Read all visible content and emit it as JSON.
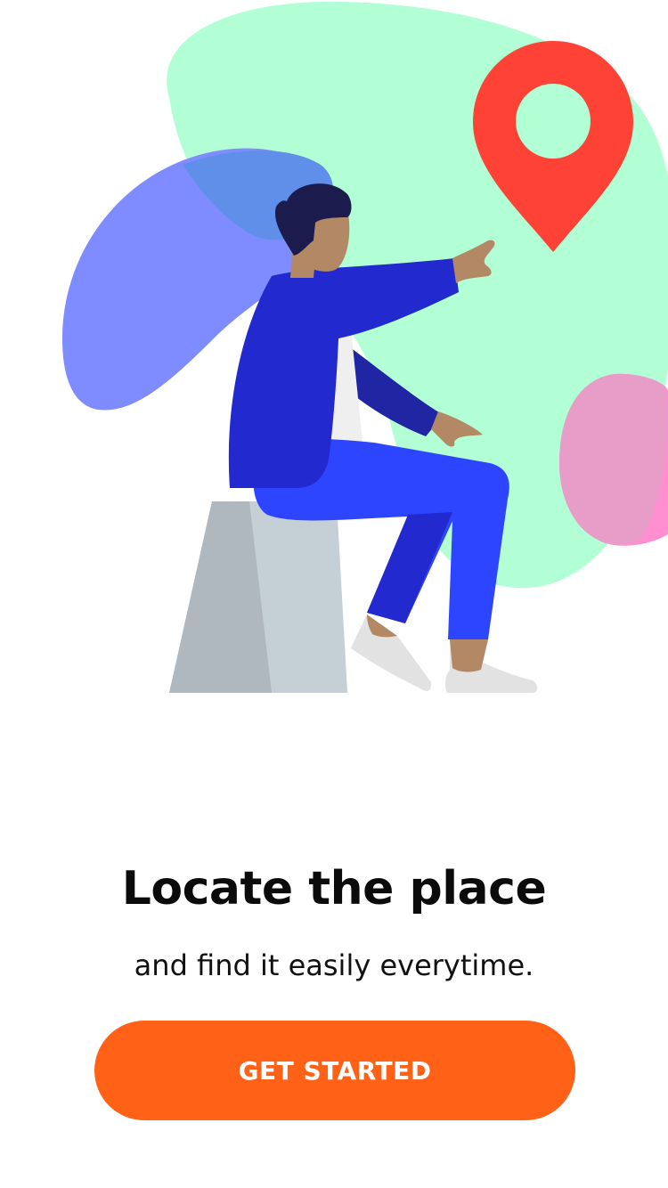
{
  "onboarding": {
    "title": "Locate the place",
    "subtitle": "and find it easily everytime.",
    "cta_label": "GET STARTED"
  },
  "illustration": {
    "icon": "location-pin-icon",
    "subject": "person-pointing"
  },
  "colors": {
    "cta_background": "#ff6116",
    "pin": "#ff4236",
    "blob_green": "#b2ffd5",
    "blob_blue": "#7f8cff",
    "blob_pink": "#ff8fd0",
    "jacket": "#2129cf",
    "pants": "#2d45ff"
  }
}
